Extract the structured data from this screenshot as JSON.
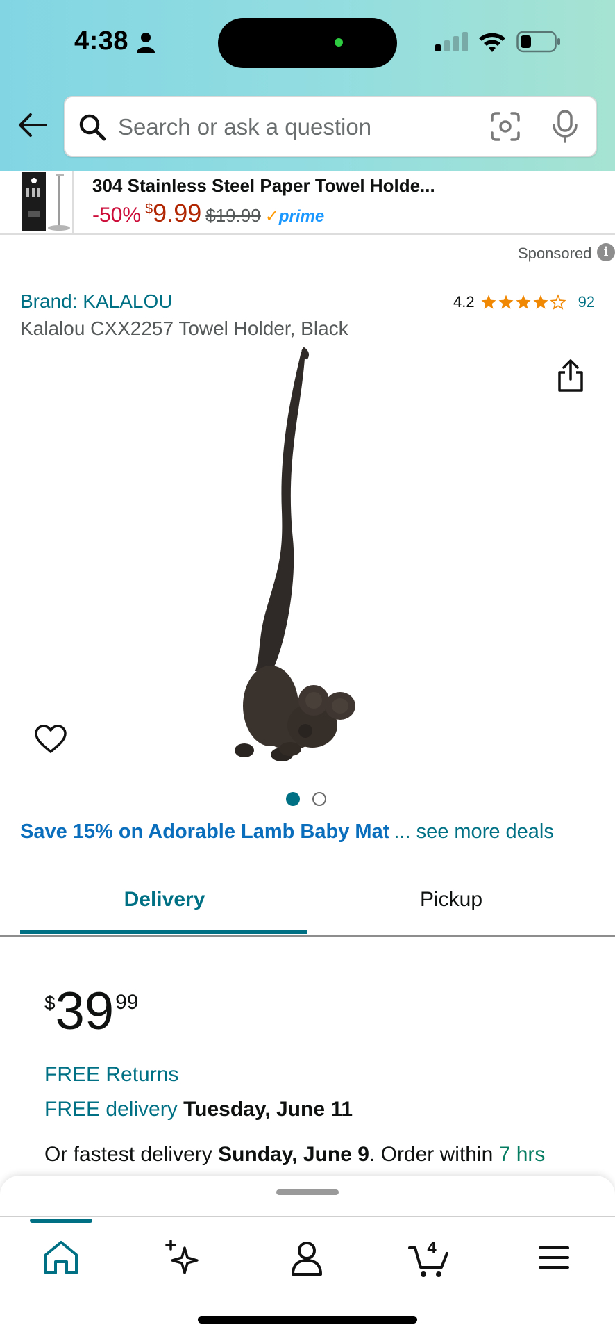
{
  "status_bar": {
    "time": "4:38"
  },
  "search": {
    "placeholder": "Search or ask a question"
  },
  "sponsored_banner": {
    "title": "304 Stainless Steel Paper Towel Holde...",
    "discount": "-50%",
    "currency": "$",
    "price": "9.99",
    "original_price": "$19.99",
    "prime": "prime"
  },
  "sponsored_label": "Sponsored",
  "product": {
    "brand": "Brand: KALALOU",
    "rating": "4.2",
    "stars": 4.2,
    "rating_count": "92",
    "title": "Kalalou CXX2257 Towel Holder, Black",
    "image_count": 2,
    "active_image": 1
  },
  "deals": {
    "deal_text": "Save 15% on Adorable Lamb Baby Mat",
    "more_text": "... see more deals"
  },
  "tabs": [
    {
      "label": "Delivery",
      "active": true
    },
    {
      "label": "Pickup",
      "active": false
    }
  ],
  "price": {
    "symbol": "$",
    "whole": "39",
    "fraction": "99"
  },
  "delivery": {
    "free_returns": "FREE Returns",
    "free_delivery_label": "FREE delivery",
    "free_delivery_date": "Tuesday, June 11",
    "fastest_prefix": "Or fastest delivery",
    "fastest_date": "Sunday, June 9",
    "order_within": ". Order within",
    "countdown": "7 hrs"
  },
  "bottom_nav": {
    "items": [
      "home-icon",
      "rufus-sparkle-icon",
      "account-icon",
      "cart-icon",
      "menu-icon"
    ],
    "cart_count": "4"
  },
  "colors": {
    "link": "#007185",
    "price_red": "#b12704",
    "discount_red": "#cc0c39",
    "star": "#f08804",
    "deal_blue": "#0a6ebd",
    "green": "#067d62"
  }
}
